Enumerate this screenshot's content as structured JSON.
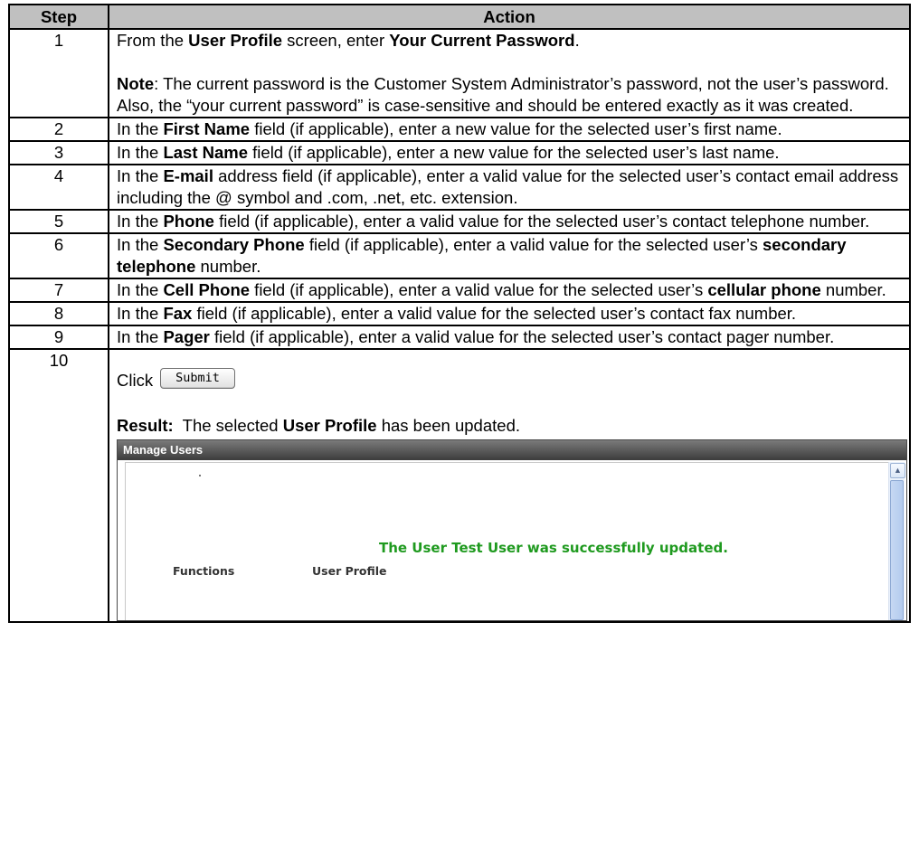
{
  "table": {
    "header_step": "Step",
    "header_action": "Action"
  },
  "rows": [
    {
      "num": "1",
      "parts": [
        [
          "From the ",
          false
        ],
        [
          "User Profile",
          true
        ],
        [
          " screen, enter ",
          false
        ],
        [
          "Your Current Password",
          true
        ],
        [
          ".",
          false
        ]
      ],
      "note_label": "Note",
      "note_text": ":  The current password is the Customer System Administrator’s password, not the user’s password.  Also, the “your current password” is case-sensitive and should be entered exactly as it was created."
    },
    {
      "num": "2",
      "parts": [
        [
          "In the ",
          false
        ],
        [
          "First Name",
          true
        ],
        [
          " field (if applicable), enter a new value for the selected user’s first name.",
          false
        ]
      ]
    },
    {
      "num": "3",
      "parts": [
        [
          "In the ",
          false
        ],
        [
          "Last Name",
          true
        ],
        [
          " field (if applicable), enter a new value for the selected user’s last name.",
          false
        ]
      ]
    },
    {
      "num": "4",
      "parts": [
        [
          "In the ",
          false
        ],
        [
          "E-mail",
          true
        ],
        [
          " address field (if applicable), enter a valid value for the selected user’s contact email address including the @ symbol and .com, .net, etc. extension.",
          false
        ]
      ]
    },
    {
      "num": "5",
      "parts": [
        [
          "In the ",
          false
        ],
        [
          "Phone",
          true
        ],
        [
          " field (if applicable), enter a valid value for the selected user’s contact telephone number.",
          false
        ]
      ]
    },
    {
      "num": "6",
      "parts": [
        [
          "In the ",
          false
        ],
        [
          "Secondary Phone",
          true
        ],
        [
          " field (if applicable), enter a valid value for the selected user’s ",
          false
        ],
        [
          "secondary telephone",
          true
        ],
        [
          " number.",
          false
        ]
      ]
    },
    {
      "num": "7",
      "parts": [
        [
          "In the ",
          false
        ],
        [
          "Cell Phone",
          true
        ],
        [
          " field (if applicable), enter a valid value for the selected user’s ",
          false
        ],
        [
          "cellular phone",
          true
        ],
        [
          " number.",
          false
        ]
      ]
    },
    {
      "num": "8",
      "parts": [
        [
          "In the ",
          false
        ],
        [
          "Fax",
          true
        ],
        [
          " field (if applicable), enter a valid value for the selected user’s contact fax number.",
          false
        ]
      ]
    },
    {
      "num": "9",
      "parts": [
        [
          "In the ",
          false
        ],
        [
          "Pager",
          true
        ],
        [
          " field (if applicable), enter a valid value for the selected user’s contact pager number.",
          false
        ]
      ]
    }
  ],
  "step10": {
    "num": "10",
    "click_label": "Click",
    "submit_label": "Submit",
    "result_label": "Result:",
    "result_text_1": "  The selected ",
    "result_bold": "User Profile",
    "result_text_2": " has been updated."
  },
  "manage_users": {
    "title": "Manage Users",
    "success_message": "The User Test User was successfully updated.",
    "col_functions": "Functions",
    "col_user_profile": "User Profile",
    "scroll_up_icon": "up-arrow-icon"
  }
}
